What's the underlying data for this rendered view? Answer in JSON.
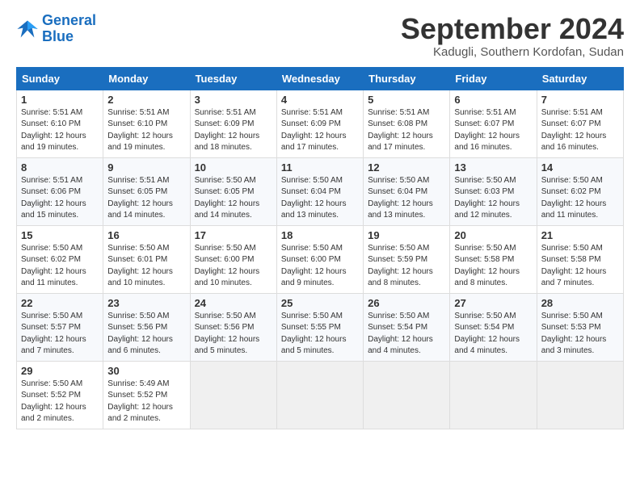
{
  "logo": {
    "line1": "General",
    "line2": "Blue"
  },
  "title": "September 2024",
  "subtitle": "Kadugli, Southern Kordofan, Sudan",
  "weekdays": [
    "Sunday",
    "Monday",
    "Tuesday",
    "Wednesday",
    "Thursday",
    "Friday",
    "Saturday"
  ],
  "weeks": [
    [
      {
        "day": "1",
        "info": "Sunrise: 5:51 AM\nSunset: 6:10 PM\nDaylight: 12 hours\nand 19 minutes."
      },
      {
        "day": "2",
        "info": "Sunrise: 5:51 AM\nSunset: 6:10 PM\nDaylight: 12 hours\nand 19 minutes."
      },
      {
        "day": "3",
        "info": "Sunrise: 5:51 AM\nSunset: 6:09 PM\nDaylight: 12 hours\nand 18 minutes."
      },
      {
        "day": "4",
        "info": "Sunrise: 5:51 AM\nSunset: 6:09 PM\nDaylight: 12 hours\nand 17 minutes."
      },
      {
        "day": "5",
        "info": "Sunrise: 5:51 AM\nSunset: 6:08 PM\nDaylight: 12 hours\nand 17 minutes."
      },
      {
        "day": "6",
        "info": "Sunrise: 5:51 AM\nSunset: 6:07 PM\nDaylight: 12 hours\nand 16 minutes."
      },
      {
        "day": "7",
        "info": "Sunrise: 5:51 AM\nSunset: 6:07 PM\nDaylight: 12 hours\nand 16 minutes."
      }
    ],
    [
      {
        "day": "8",
        "info": "Sunrise: 5:51 AM\nSunset: 6:06 PM\nDaylight: 12 hours\nand 15 minutes."
      },
      {
        "day": "9",
        "info": "Sunrise: 5:51 AM\nSunset: 6:05 PM\nDaylight: 12 hours\nand 14 minutes."
      },
      {
        "day": "10",
        "info": "Sunrise: 5:50 AM\nSunset: 6:05 PM\nDaylight: 12 hours\nand 14 minutes."
      },
      {
        "day": "11",
        "info": "Sunrise: 5:50 AM\nSunset: 6:04 PM\nDaylight: 12 hours\nand 13 minutes."
      },
      {
        "day": "12",
        "info": "Sunrise: 5:50 AM\nSunset: 6:04 PM\nDaylight: 12 hours\nand 13 minutes."
      },
      {
        "day": "13",
        "info": "Sunrise: 5:50 AM\nSunset: 6:03 PM\nDaylight: 12 hours\nand 12 minutes."
      },
      {
        "day": "14",
        "info": "Sunrise: 5:50 AM\nSunset: 6:02 PM\nDaylight: 12 hours\nand 11 minutes."
      }
    ],
    [
      {
        "day": "15",
        "info": "Sunrise: 5:50 AM\nSunset: 6:02 PM\nDaylight: 12 hours\nand 11 minutes."
      },
      {
        "day": "16",
        "info": "Sunrise: 5:50 AM\nSunset: 6:01 PM\nDaylight: 12 hours\nand 10 minutes."
      },
      {
        "day": "17",
        "info": "Sunrise: 5:50 AM\nSunset: 6:00 PM\nDaylight: 12 hours\nand 10 minutes."
      },
      {
        "day": "18",
        "info": "Sunrise: 5:50 AM\nSunset: 6:00 PM\nDaylight: 12 hours\nand 9 minutes."
      },
      {
        "day": "19",
        "info": "Sunrise: 5:50 AM\nSunset: 5:59 PM\nDaylight: 12 hours\nand 8 minutes."
      },
      {
        "day": "20",
        "info": "Sunrise: 5:50 AM\nSunset: 5:58 PM\nDaylight: 12 hours\nand 8 minutes."
      },
      {
        "day": "21",
        "info": "Sunrise: 5:50 AM\nSunset: 5:58 PM\nDaylight: 12 hours\nand 7 minutes."
      }
    ],
    [
      {
        "day": "22",
        "info": "Sunrise: 5:50 AM\nSunset: 5:57 PM\nDaylight: 12 hours\nand 7 minutes."
      },
      {
        "day": "23",
        "info": "Sunrise: 5:50 AM\nSunset: 5:56 PM\nDaylight: 12 hours\nand 6 minutes."
      },
      {
        "day": "24",
        "info": "Sunrise: 5:50 AM\nSunset: 5:56 PM\nDaylight: 12 hours\nand 5 minutes."
      },
      {
        "day": "25",
        "info": "Sunrise: 5:50 AM\nSunset: 5:55 PM\nDaylight: 12 hours\nand 5 minutes."
      },
      {
        "day": "26",
        "info": "Sunrise: 5:50 AM\nSunset: 5:54 PM\nDaylight: 12 hours\nand 4 minutes."
      },
      {
        "day": "27",
        "info": "Sunrise: 5:50 AM\nSunset: 5:54 PM\nDaylight: 12 hours\nand 4 minutes."
      },
      {
        "day": "28",
        "info": "Sunrise: 5:50 AM\nSunset: 5:53 PM\nDaylight: 12 hours\nand 3 minutes."
      }
    ],
    [
      {
        "day": "29",
        "info": "Sunrise: 5:50 AM\nSunset: 5:52 PM\nDaylight: 12 hours\nand 2 minutes."
      },
      {
        "day": "30",
        "info": "Sunrise: 5:49 AM\nSunset: 5:52 PM\nDaylight: 12 hours\nand 2 minutes."
      },
      null,
      null,
      null,
      null,
      null
    ]
  ]
}
